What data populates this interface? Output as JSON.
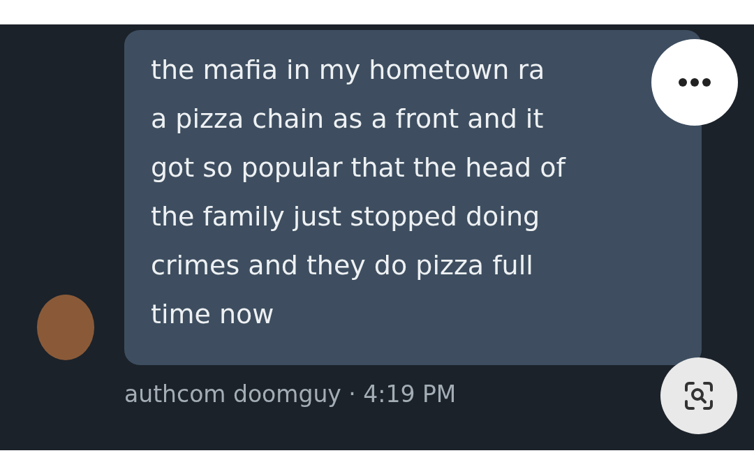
{
  "message": {
    "lines": [
      "the mafia in my hometown ra",
      "a pizza chain as a front and it",
      "got so popular that the head of",
      "the family just stopped doing",
      "crimes and they do pizza full",
      "time now"
    ]
  },
  "meta": "authcom doomguy · 4:19 PM"
}
